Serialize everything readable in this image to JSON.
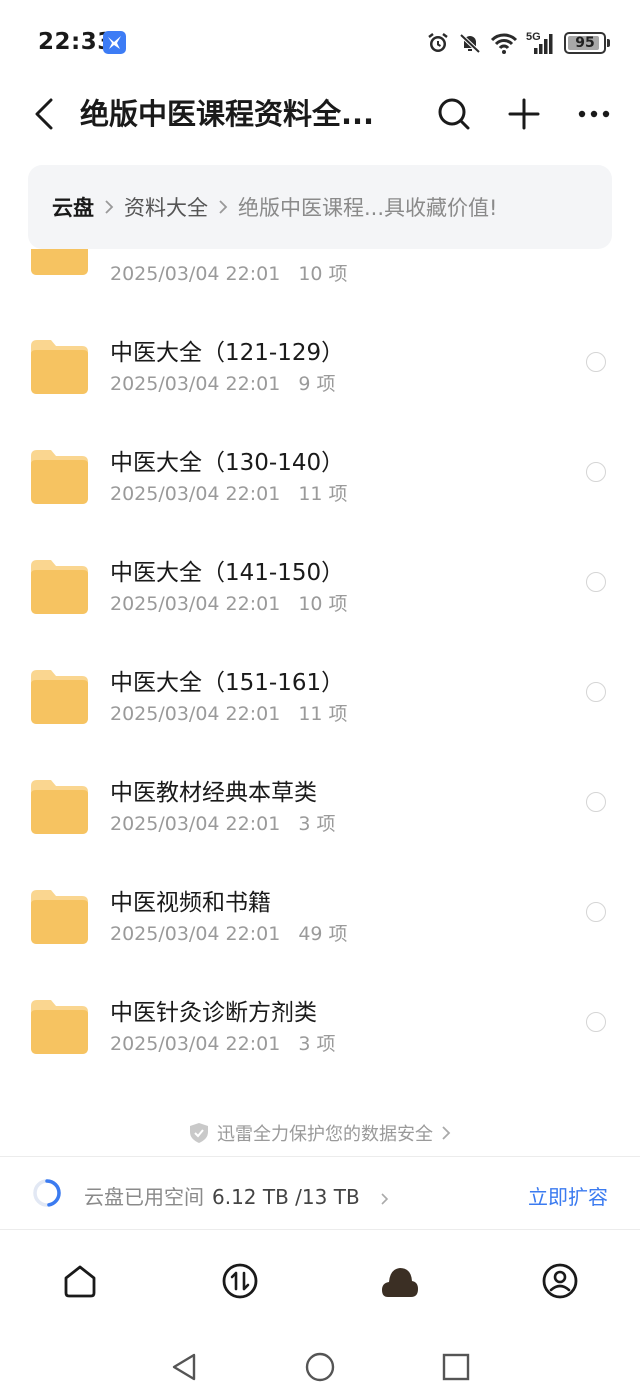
{
  "status_bar": {
    "time": "22:33",
    "network": "5G",
    "battery": "95",
    "battery_level": 0.95,
    "icons": [
      "alarm-icon",
      "mute-icon",
      "wifi-icon",
      "signal-icon",
      "battery-icon"
    ]
  },
  "header": {
    "title": "绝版中医课程资料全...",
    "icons": [
      "back-icon",
      "search-icon",
      "plus-icon",
      "more-icon"
    ]
  },
  "breadcrumb": {
    "items": [
      "云盘",
      "资料大全",
      "绝版中医课程...具收藏价值!"
    ]
  },
  "list": {
    "partial_item": {
      "date": "2025/03/04 22:01",
      "count": "10 项"
    },
    "items": [
      {
        "name": "中医大全（121-129）",
        "date": "2025/03/04 22:01",
        "count": "9 项"
      },
      {
        "name": "中医大全（130-140）",
        "date": "2025/03/04 22:01",
        "count": "11 项"
      },
      {
        "name": "中医大全（141-150）",
        "date": "2025/03/04 22:01",
        "count": "10 项"
      },
      {
        "name": "中医大全（151-161）",
        "date": "2025/03/04 22:01",
        "count": "11 项"
      },
      {
        "name": "中医教材经典本草类",
        "date": "2025/03/04 22:01",
        "count": "3 项"
      },
      {
        "name": "中医视频和书籍",
        "date": "2025/03/04 22:01",
        "count": "49 项"
      },
      {
        "name": "中医针灸诊断方剂类",
        "date": "2025/03/04 22:01",
        "count": "3 项"
      }
    ]
  },
  "security_note": "迅雷全力保护您的数据安全",
  "storage": {
    "label": "云盘已用空间",
    "value": "6.12 TB /13 TB",
    "used_fraction": 0.47,
    "expand": "立即扩容"
  },
  "tabs": [
    "home-icon",
    "transfer-icon",
    "cloud-icon",
    "profile-icon"
  ],
  "colors": {
    "accent": "#3b7bf0",
    "folder": "#f6c361",
    "folder_light": "#fad690"
  }
}
